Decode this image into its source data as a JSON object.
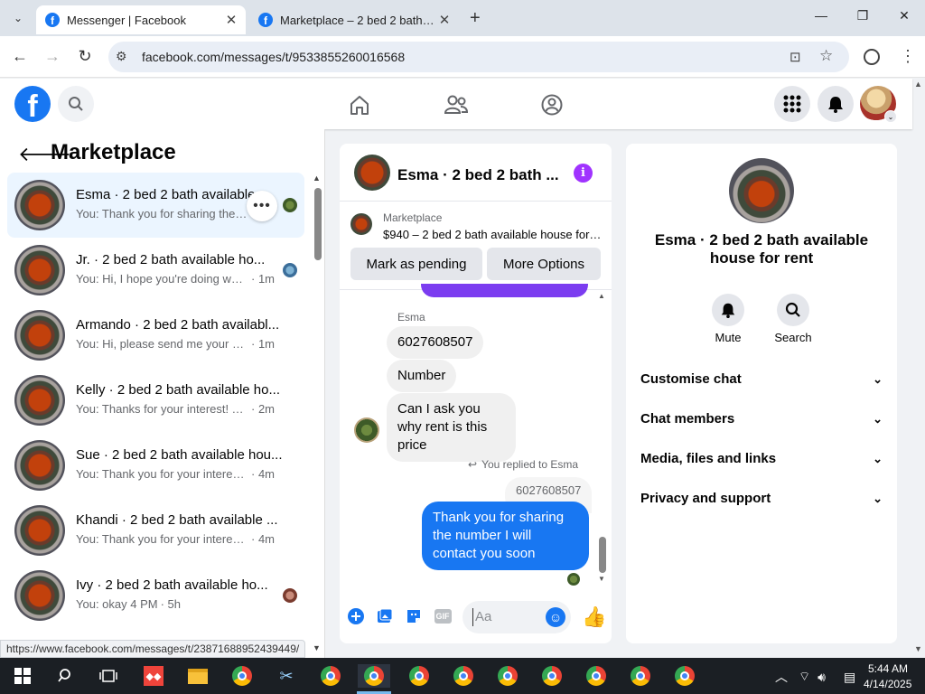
{
  "browser": {
    "tabs": [
      {
        "title": "Messenger | Facebook",
        "active": true
      },
      {
        "title": "Marketplace – 2 bed 2 bath ava",
        "active": false
      }
    ],
    "url": "facebook.com/messages/t/9533855260016568",
    "status_link": "https://www.facebook.com/messages/t/23871688952439449/"
  },
  "left": {
    "title": "Marketplace",
    "conversations": [
      {
        "name": "Esma · 2 bed 2 bath available",
        "preview": "You: Thank you for sharing the ...",
        "time": ""
      },
      {
        "name": "Jr. · 2 bed 2 bath available ho...",
        "preview": "You: Hi, I hope you're doing well...",
        "time": "· 1m"
      },
      {
        "name": "Armando · 2 bed 2 bath availabl...",
        "preview": "You: Hi, please send me your num...",
        "time": "· 1m"
      },
      {
        "name": "Kelly · 2 bed 2 bath available ho...",
        "preview": "You: Thanks for your interest! The r...",
        "time": "· 2m"
      },
      {
        "name": "Sue · 2 bed 2 bath available hou...",
        "preview": "You: Thank you for your interest! Y...",
        "time": "· 4m"
      },
      {
        "name": "Khandi · 2 bed 2 bath available ...",
        "preview": "You: Thank you for your interest! Y...",
        "time": "· 4m"
      },
      {
        "name": "Ivy · 2 bed 2 bath available ho...",
        "preview": "You: okay 4 PM",
        "time": "· 5h"
      }
    ]
  },
  "chat": {
    "header_name": "Esma · 2 bed 2 bath ...",
    "listing_label": "Marketplace",
    "listing_title": "$940 – 2 bed 2 bath available house for ...",
    "mark_pending": "Mark as pending",
    "more_options": "More Options",
    "sender": "Esma",
    "incoming": [
      "6027608507",
      "Number",
      "Can I ask you why rent is this price"
    ],
    "replied_label": "You replied to Esma",
    "quoted": "6027608507",
    "outgoing": "Thank you for sharing the number I will contact you soon",
    "compose_placeholder": "Aa",
    "gif_label": "GIF"
  },
  "details": {
    "name": "Esma · 2 bed 2 bath available house for rent",
    "mute": "Mute",
    "search": "Search",
    "sections": [
      "Customise chat",
      "Chat members",
      "Media, files and links",
      "Privacy and support"
    ]
  },
  "taskbar": {
    "time": "5:44 AM",
    "date": "4/14/2025"
  },
  "colors": {
    "accent": "#1877f2",
    "info": "#a033ff"
  }
}
